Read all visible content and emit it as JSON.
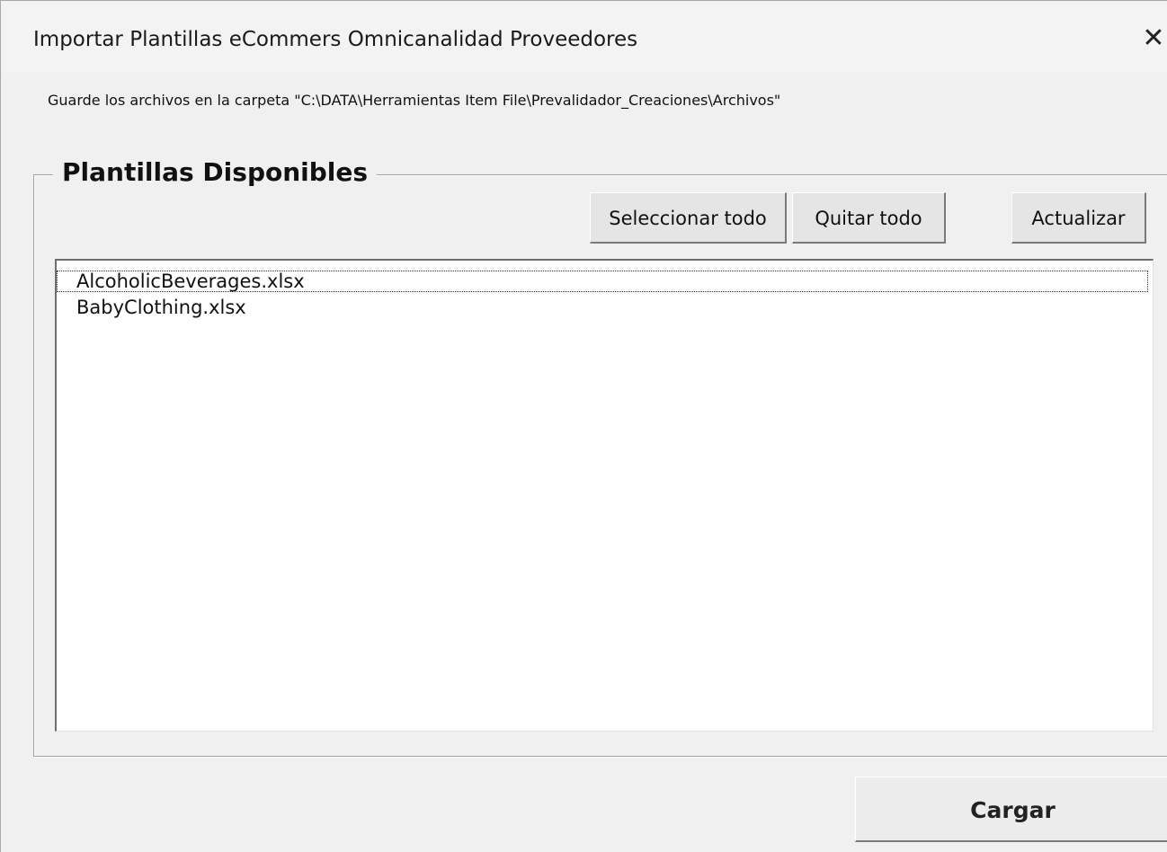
{
  "window": {
    "title": "Importar Plantillas eCommers Omnicanalidad Proveedores",
    "close_glyph": "✕",
    "close_icon": "close-icon"
  },
  "folder_note": "Guarde los archivos en la carpeta \"C:\\DATA\\Herramientas Item File\\Prevalidador_Creaciones\\Archivos\"",
  "frame": {
    "caption": "Plantillas Disponibles"
  },
  "buttons": {
    "select_all": "Seleccionar todo",
    "clear_all": "Quitar todo",
    "refresh": "Actualizar",
    "load": "Cargar"
  },
  "templates": [
    "AlcoholicBeverages.xlsx",
    "BabyClothing.xlsx"
  ]
}
